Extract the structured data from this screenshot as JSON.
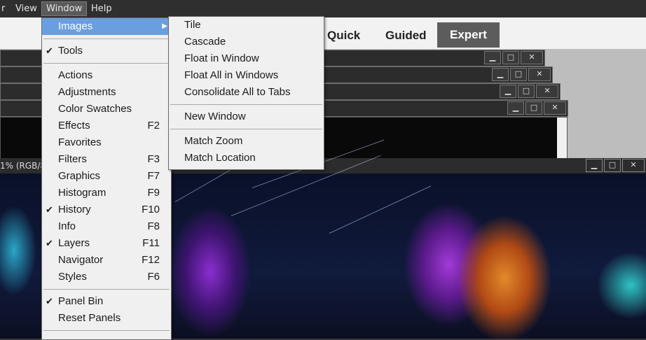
{
  "menubar": {
    "items": [
      "r",
      "View",
      "Window",
      "Help"
    ],
    "active_index": 2
  },
  "modes": {
    "quick": "Quick",
    "guided": "Guided",
    "expert": "Expert"
  },
  "icons": {
    "minimize": "minimize-icon",
    "restore": "restore-icon",
    "close": "close-icon",
    "check": "checkmark-icon",
    "submenu": "submenu-arrow-icon"
  },
  "window_buttons": {
    "minimize": "▁",
    "restore": "□",
    "close": "✕"
  },
  "document": {
    "title_fragment": "1% (RGB/8"
  },
  "window_menu": {
    "items": [
      {
        "label": "Images",
        "has_submenu": true,
        "highlighted": true
      },
      {
        "sep": true
      },
      {
        "label": "Tools",
        "checked": true
      },
      {
        "sep": true
      },
      {
        "label": "Actions"
      },
      {
        "label": "Adjustments"
      },
      {
        "label": "Color Swatches"
      },
      {
        "label": "Effects",
        "shortcut": "F2"
      },
      {
        "label": "Favorites"
      },
      {
        "label": "Filters",
        "shortcut": "F3"
      },
      {
        "label": "Graphics",
        "shortcut": "F7"
      },
      {
        "label": "Histogram",
        "shortcut": "F9"
      },
      {
        "label": "History",
        "shortcut": "F10",
        "checked": true
      },
      {
        "label": "Info",
        "shortcut": "F8"
      },
      {
        "label": "Layers",
        "shortcut": "F11",
        "checked": true
      },
      {
        "label": "Navigator",
        "shortcut": "F12"
      },
      {
        "label": "Styles",
        "shortcut": "F6"
      },
      {
        "sep": true
      },
      {
        "label": "Panel Bin",
        "checked": true
      },
      {
        "label": "Reset Panels"
      },
      {
        "sep": true
      }
    ]
  },
  "images_submenu": {
    "items": [
      {
        "label": "Tile"
      },
      {
        "label": "Cascade"
      },
      {
        "label": "Float in Window"
      },
      {
        "label": "Float All in Windows"
      },
      {
        "label": "Consolidate All to Tabs"
      },
      {
        "sep": true
      },
      {
        "label": "New Window"
      },
      {
        "sep": true
      },
      {
        "label": "Match Zoom"
      },
      {
        "label": "Match Location"
      }
    ]
  },
  "colors": {
    "highlight": "#6a9fdf",
    "menu_bg": "#f0f0f0",
    "expert_bg": "#5c5c5c"
  }
}
